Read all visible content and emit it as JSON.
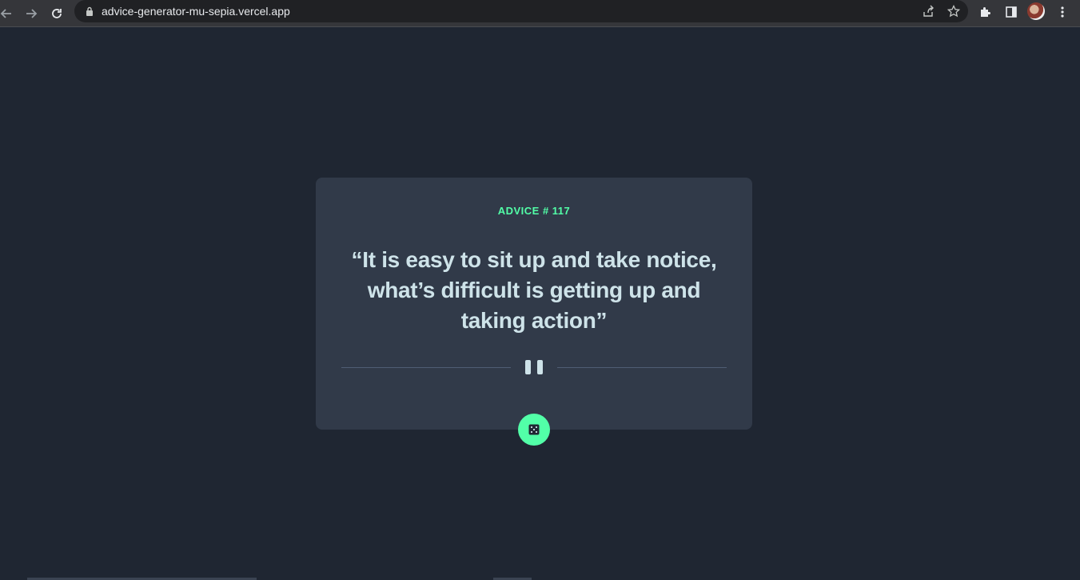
{
  "browser": {
    "url": "advice-generator-mu-sepia.vercel.app",
    "icons": [
      "back-arrow-icon",
      "forward-arrow-icon",
      "reload-icon",
      "lock-icon",
      "share-icon",
      "bookmark-star-icon",
      "extensions-puzzle-icon",
      "side-panel-icon",
      "profile-avatar",
      "menu-kebab-icon"
    ]
  },
  "advice": {
    "label": "ADVICE # 117",
    "quote": "“It is easy to sit up and take notice, what’s difficult is getting up and taking action”"
  },
  "colors": {
    "page_bg": "#1f2632",
    "card_bg": "#313a49",
    "accent": "#52ffa8",
    "quote_text": "#cee3e9",
    "divider": "#4f5d74"
  }
}
